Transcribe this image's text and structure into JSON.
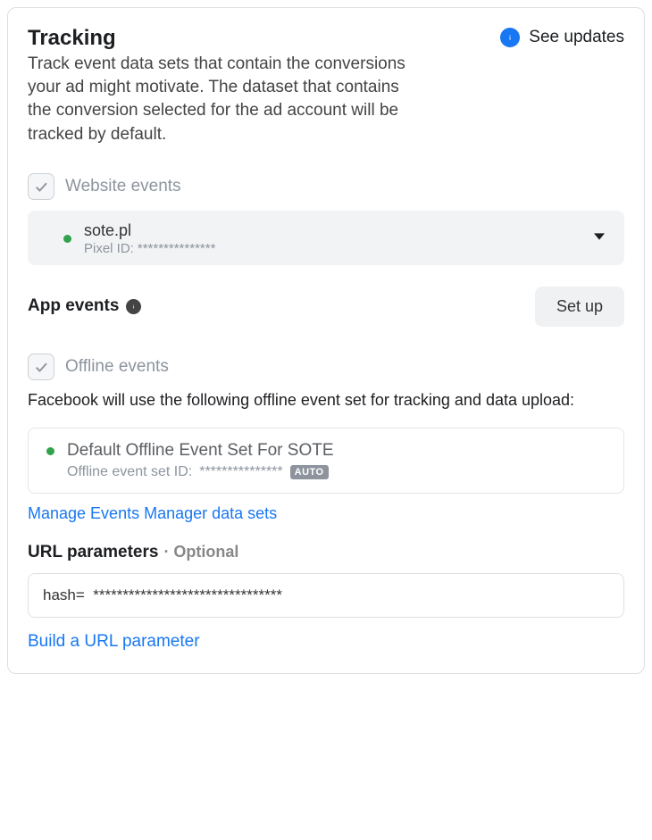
{
  "header": {
    "title": "Tracking",
    "subtitle": "Track event data sets that contain the conversions your ad might motivate. The dataset that contains the conversion selected for the ad account will be tracked by default.",
    "see_updates": "See updates"
  },
  "website_events": {
    "label": "Website events",
    "pixel_name": "sote.pl",
    "pixel_id_label": "Pixel ID:",
    "pixel_id_value": "***************"
  },
  "app_events": {
    "label": "App events",
    "setup_btn": "Set up"
  },
  "offline_events": {
    "label": "Offline events",
    "description": "Facebook will use the following offline event set for tracking and data upload:",
    "set_name": "Default Offline Event Set For SOTE",
    "set_id_label": "Offline event set ID:",
    "set_id_value": "***************",
    "auto_badge": "AUTO"
  },
  "links": {
    "manage": "Manage Events Manager data sets",
    "build": "Build a URL parameter"
  },
  "url_params": {
    "label": "URL parameters",
    "optional": "· Optional",
    "value": "hash=  ********************************"
  }
}
